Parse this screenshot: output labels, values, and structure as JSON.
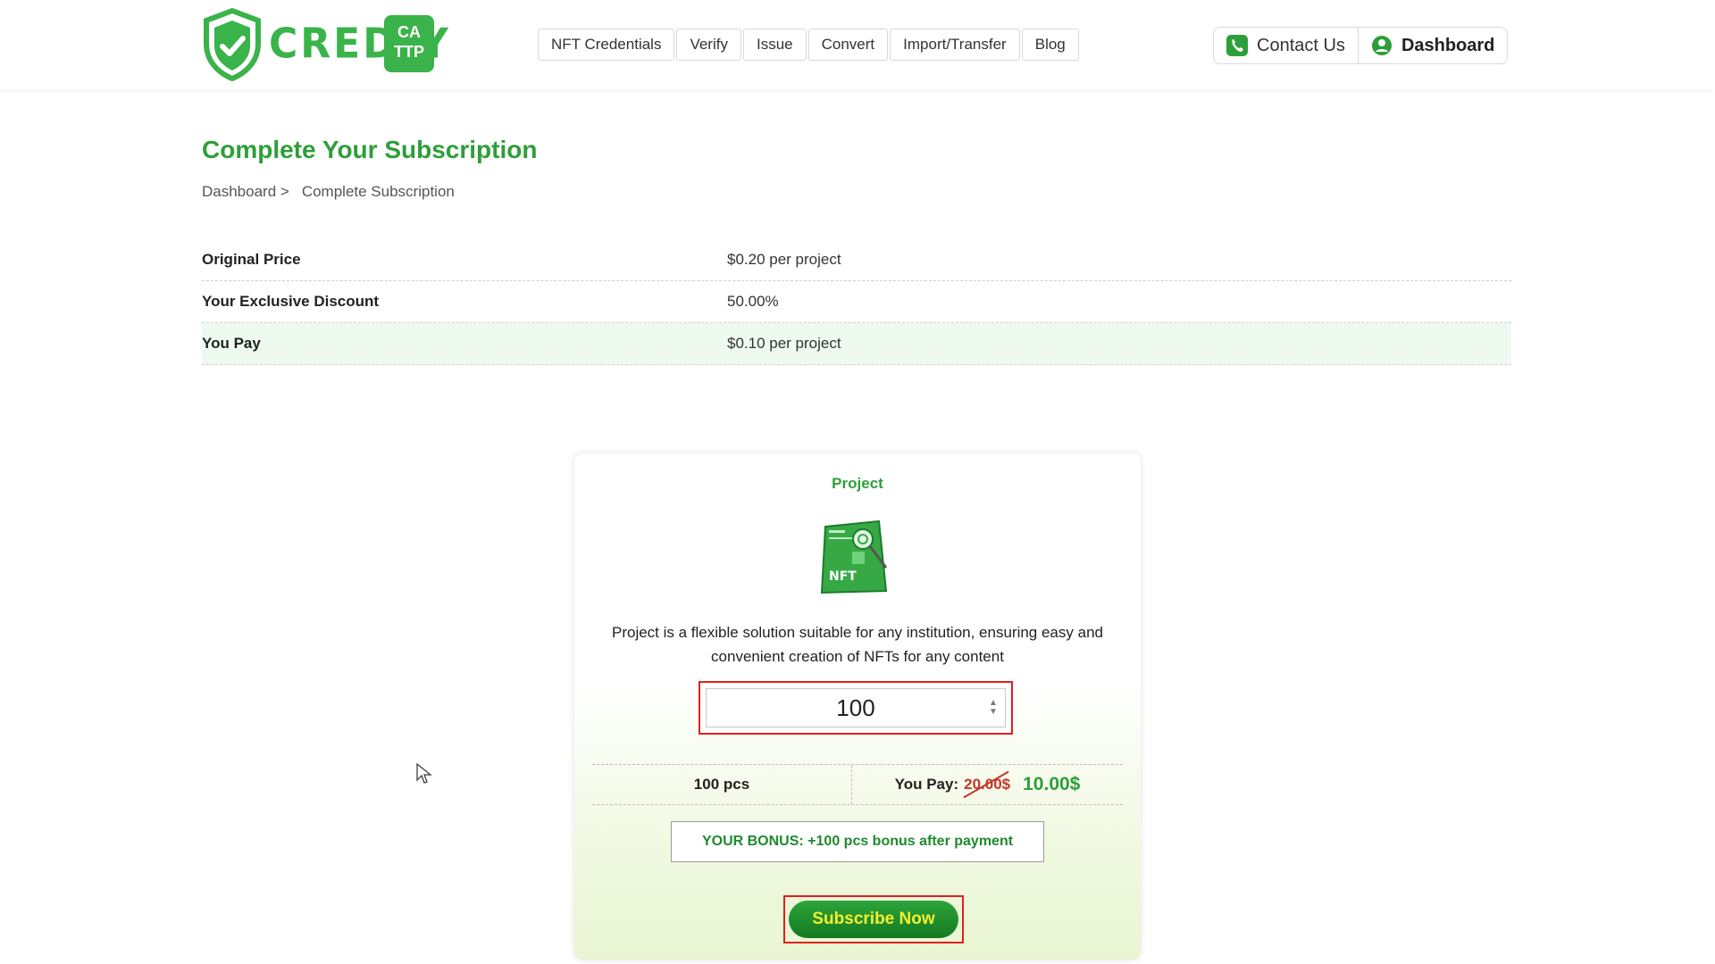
{
  "header": {
    "logo": {
      "text": "CREDLY",
      "badge_line1": "CA",
      "badge_line2": "TTP"
    },
    "nav": [
      {
        "label": "NFT Credentials"
      },
      {
        "label": "Verify"
      },
      {
        "label": "Issue"
      },
      {
        "label": "Convert"
      },
      {
        "label": "Import/Transfer"
      },
      {
        "label": "Blog"
      }
    ],
    "contact_label": "Contact Us",
    "dashboard_label": "Dashboard"
  },
  "page": {
    "title": "Complete Your Subscription",
    "breadcrumb": {
      "parent": "Dashboard >",
      "current": "Complete Subscription"
    }
  },
  "pricing": [
    {
      "label": "Original Price",
      "value": "$0.20 per project"
    },
    {
      "label": "Your Exclusive Discount",
      "value": "50.00%"
    },
    {
      "label": "You Pay",
      "value": "$0.10 per project"
    }
  ],
  "card": {
    "title": "Project",
    "image_label": "NFT",
    "description": "Project is a flexible solution suitable for any institution, ensuring easy and convenient creation of NFTs for any content",
    "quantity": "100",
    "pcs_label": "100 pcs",
    "you_pay_label": "You Pay:",
    "old_price": "20.00$",
    "new_price": "10.00$",
    "bonus": "YOUR BONUS: +100 pcs bonus after payment",
    "subscribe_label": "Subscribe Now"
  },
  "colors": {
    "brand_green": "#3ab34a",
    "title_green": "#2e9e3a",
    "button_text": "#f5ee2f",
    "highlight_red": "#e02020"
  }
}
